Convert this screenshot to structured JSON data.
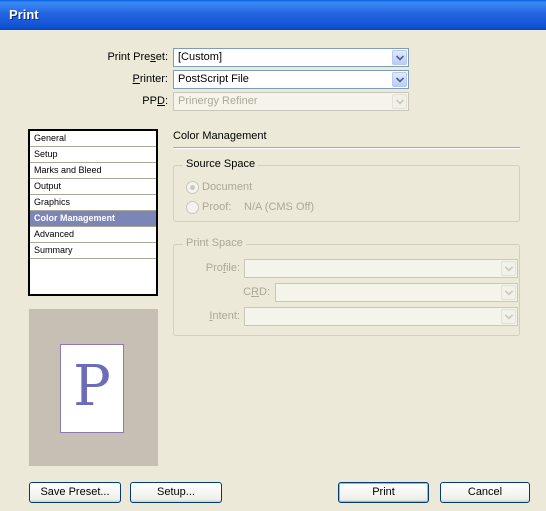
{
  "window": {
    "title": "Print"
  },
  "preset": {
    "label_pre": "Print Pre",
    "label_mnemonic": "s",
    "label_post": "et:",
    "value": "[Custom]"
  },
  "printer": {
    "label_mnemonic": "P",
    "label_post": "rinter:",
    "value": "PostScript File"
  },
  "ppd": {
    "label_pre": "PP",
    "label_mnemonic": "D",
    "label_post": ":",
    "value": "Prinergy Refiner"
  },
  "categories": [
    {
      "label": "General"
    },
    {
      "label": "Setup"
    },
    {
      "label": "Marks and Bleed"
    },
    {
      "label": "Output"
    },
    {
      "label": "Graphics"
    },
    {
      "label": "Color Management",
      "selected": true
    },
    {
      "label": "Advanced"
    },
    {
      "label": "Summary"
    }
  ],
  "preview": {
    "glyph": "P"
  },
  "panel": {
    "title": "Color Management"
  },
  "source_space": {
    "legend": "Source Space",
    "document_label": "Document",
    "proof_label": "Proof:",
    "proof_value": "N/A (CMS Off)",
    "selected": "document"
  },
  "print_space": {
    "legend": "Print Space",
    "profile": {
      "label_pre": "Pro",
      "label_mnemonic": "f",
      "label_post": "ile:",
      "value": ""
    },
    "crd": {
      "label_pre": "C",
      "label_mnemonic": "R",
      "label_post": "D:",
      "value": ""
    },
    "intent": {
      "label_mnemonic": "I",
      "label_post": "ntent:",
      "value": ""
    }
  },
  "buttons": {
    "save_preset": "Save Preset...",
    "setup": "Setup...",
    "print": "Print",
    "cancel": "Cancel"
  },
  "colors": {
    "titlebar": "#0a5ee0",
    "dialog_bg": "#ece9d8",
    "selected_category": "#7b86b6",
    "preview_bg": "#c5bfb4",
    "preview_glyph": "#6c6cb8",
    "disabled_text": "#aca899"
  }
}
